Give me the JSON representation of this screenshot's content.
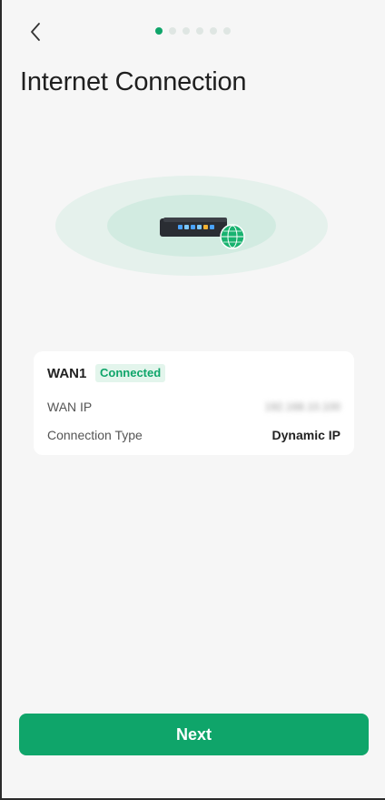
{
  "header": {
    "back_icon": "chevron-left-icon",
    "steps_total": 6,
    "current_step": 1
  },
  "page": {
    "title": "Internet Connection"
  },
  "illustration": {
    "device_icon": "router-icon",
    "globe_icon": "globe-icon"
  },
  "wan": {
    "name": "WAN1",
    "status": "Connected",
    "ip_label": "WAN IP",
    "ip_value": "192.168.10.100",
    "type_label": "Connection Type",
    "type_value": "Dynamic IP"
  },
  "footer": {
    "next_label": "Next"
  },
  "colors": {
    "accent": "#0fa56a",
    "badge_bg": "#e3f5ec",
    "background": "#f6f6f6",
    "card": "#ffffff"
  }
}
